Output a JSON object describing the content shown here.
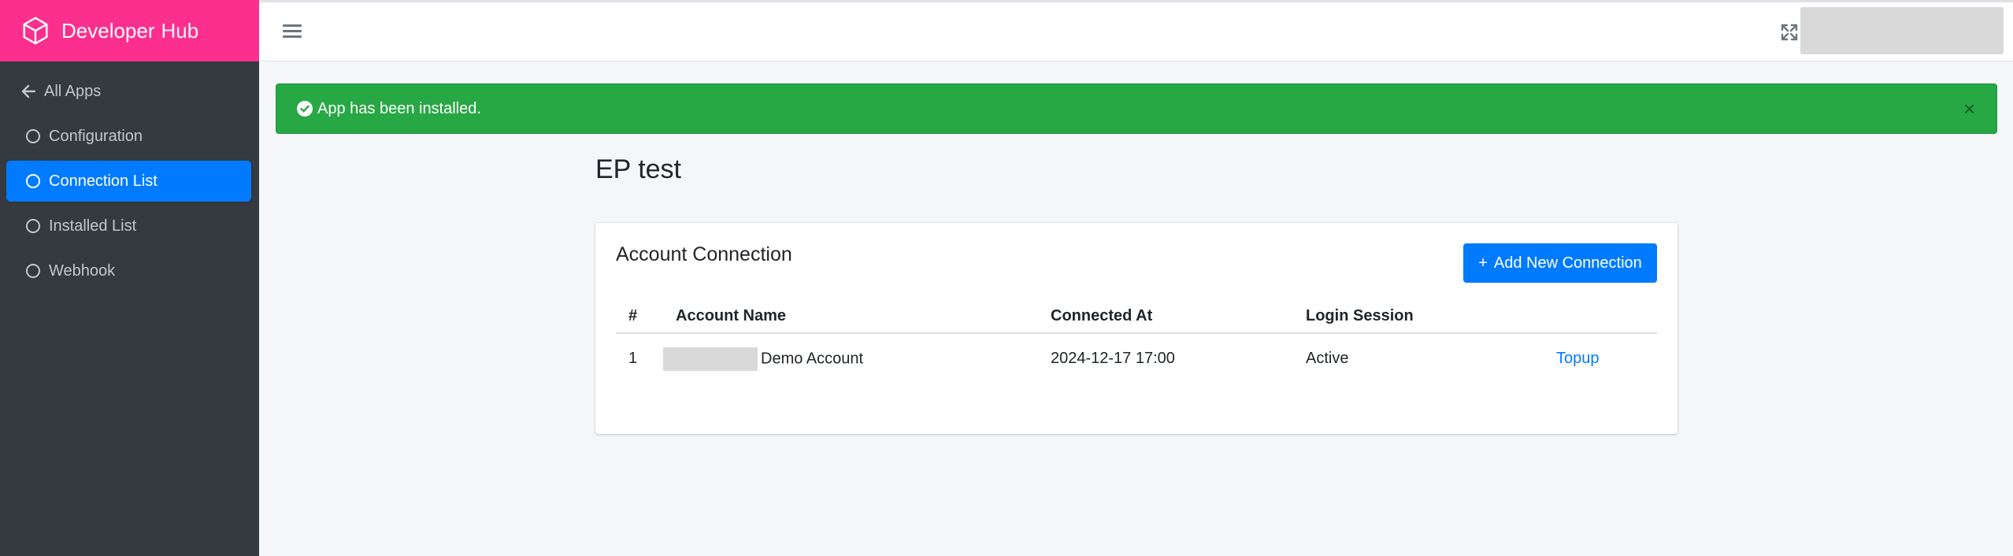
{
  "brand": {
    "name_strong": "Developer",
    "name_light": "Hub"
  },
  "sidebar": {
    "back_label": "All Apps",
    "items": [
      {
        "label": "Configuration",
        "active": false
      },
      {
        "label": "Connection List",
        "active": true
      },
      {
        "label": "Installed List",
        "active": false
      },
      {
        "label": "Webhook",
        "active": false
      }
    ]
  },
  "alert": {
    "message": "App has been installed.",
    "close": "×"
  },
  "page": {
    "title": "EP test"
  },
  "card": {
    "title": "Account Connection",
    "add_button": "Add New Connection",
    "columns": [
      "#",
      "Account Name",
      "Connected At",
      "Login Session",
      ""
    ],
    "rows": [
      {
        "num": "1",
        "name": "Demo Account",
        "connected_at": "2024-12-17 17:00",
        "session": "Active",
        "action": "Topup"
      }
    ]
  },
  "colors": {
    "brand": "#fd2f8e",
    "sidebar": "#343a40",
    "primary": "#007bff",
    "success": "#28a745"
  }
}
